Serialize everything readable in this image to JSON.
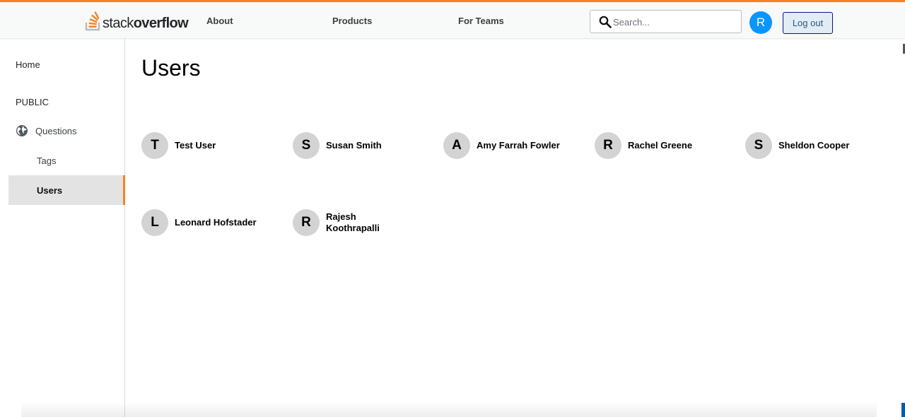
{
  "header": {
    "logo": {
      "light": "stack",
      "bold": "overflow"
    },
    "nav": [
      {
        "label": "About"
      },
      {
        "label": "Products"
      },
      {
        "label": "For Teams"
      }
    ],
    "search": {
      "placeholder": "Search...",
      "value": ""
    },
    "avatar_initial": "R",
    "logout_label": "Log out",
    "accent_color": "#f48225"
  },
  "sidebar": {
    "home": "Home",
    "section": "PUBLIC",
    "questions": "Questions",
    "tags": "Tags",
    "users": "Users"
  },
  "main": {
    "title": "Users",
    "users": [
      {
        "initial": "T",
        "name": "Test User"
      },
      {
        "initial": "S",
        "name": "Susan Smith"
      },
      {
        "initial": "A",
        "name": "Amy Farrah Fowler"
      },
      {
        "initial": "R",
        "name": "Rachel Greene"
      },
      {
        "initial": "S",
        "name": "Sheldon Cooper"
      },
      {
        "initial": "L",
        "name": "Leonard Hofstader"
      },
      {
        "initial": "R",
        "name": "Rajesh Koothrapalli"
      }
    ]
  }
}
